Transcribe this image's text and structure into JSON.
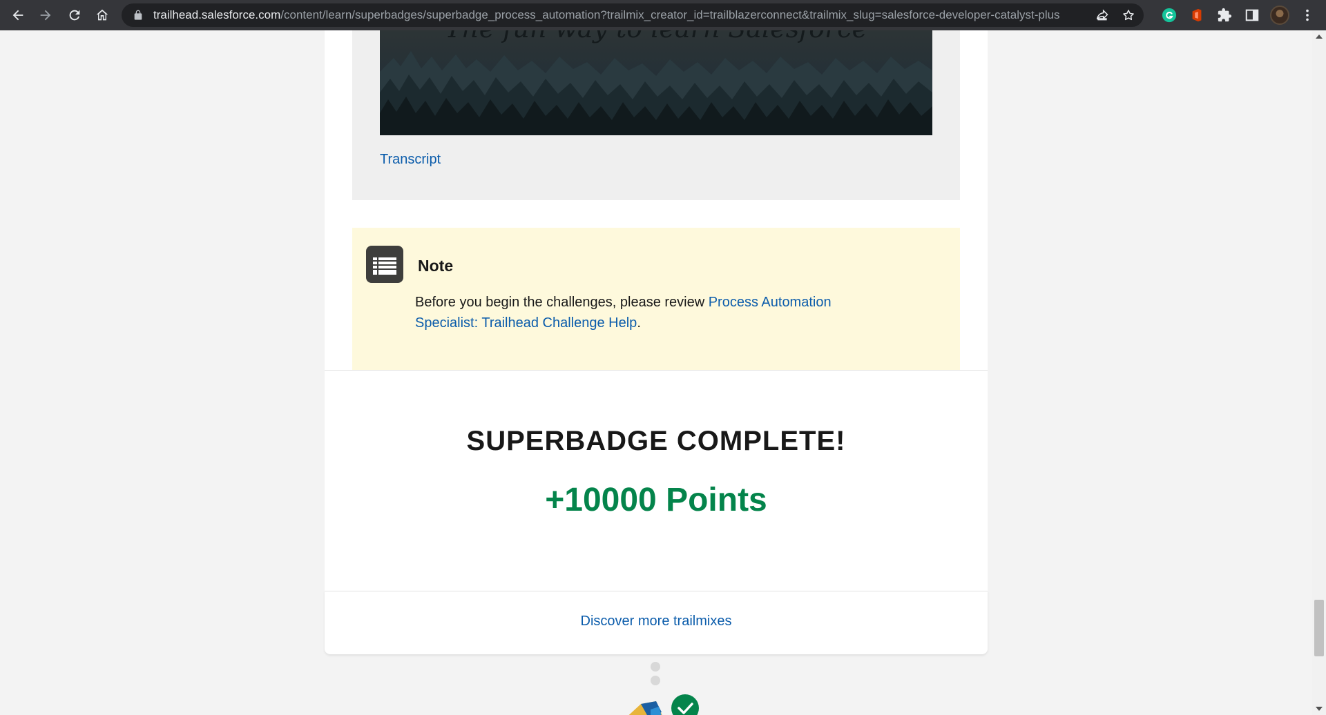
{
  "browser": {
    "url_host": "trailhead.salesforce.com",
    "url_path": "/content/learn/superbadges/superbadge_process_automation?trailmix_creator_id=trailblazerconnect&trailmix_slug=salesforce-developer-catalyst-plus"
  },
  "video": {
    "caption_text": "The fun way to learn Salesforce",
    "transcript_link": "Transcript"
  },
  "note": {
    "title": "Note",
    "body_prefix": "Before you begin the challenges, please review ",
    "link_text": "Process Automation Specialist: Trailhead Challenge Help",
    "body_suffix": "."
  },
  "completion": {
    "title": "SUPERBADGE COMPLETE!",
    "points": "+10000 Points",
    "discover_link": "Discover more trailmixes"
  },
  "colors": {
    "link": "#0b5cab",
    "points_green": "#04844b",
    "note_bg": "#fef9dc"
  }
}
